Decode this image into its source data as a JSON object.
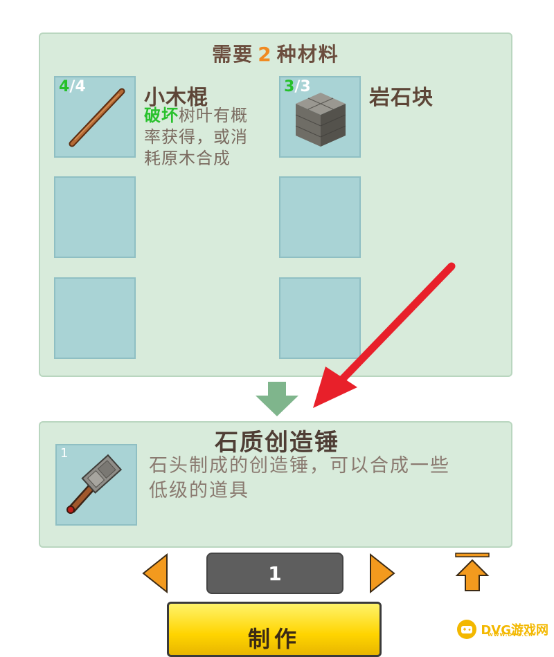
{
  "materials": {
    "title_prefix": "需要",
    "title_count": "2",
    "title_suffix": "种材料",
    "items": [
      {
        "qty_have": "4",
        "qty_sep": "/",
        "qty_need": "4",
        "name": "小木棍",
        "desc_highlight": "破坏",
        "desc_line1_rest": "树叶有概",
        "desc_line2": "率获得，或消",
        "desc_line3": "耗原木合成",
        "icon": "wooden-stick-icon"
      },
      {
        "qty_have": "3",
        "qty_sep": "/",
        "qty_need": "3",
        "name": "岩石块",
        "icon": "stone-block-icon"
      }
    ]
  },
  "result": {
    "name": "石质创造锤",
    "qty": "1",
    "desc_line1": "石头制成的创造锤，可以合成一些",
    "desc_line2": "低级的道具",
    "icon": "stone-hammer-icon"
  },
  "pager": {
    "current": "1"
  },
  "craft_button": {
    "label": "制作"
  },
  "watermark": {
    "text": "DVG游戏网",
    "sub": "WWW.DVG.CN"
  },
  "colors": {
    "panel_bg": "#d8ebdb",
    "slot_bg": "#a9d3d5",
    "accent_orange": "#f08a22",
    "have_green": "#25c02a",
    "annotation_red": "#e8202a",
    "craft_yellow": "#ffd400"
  }
}
